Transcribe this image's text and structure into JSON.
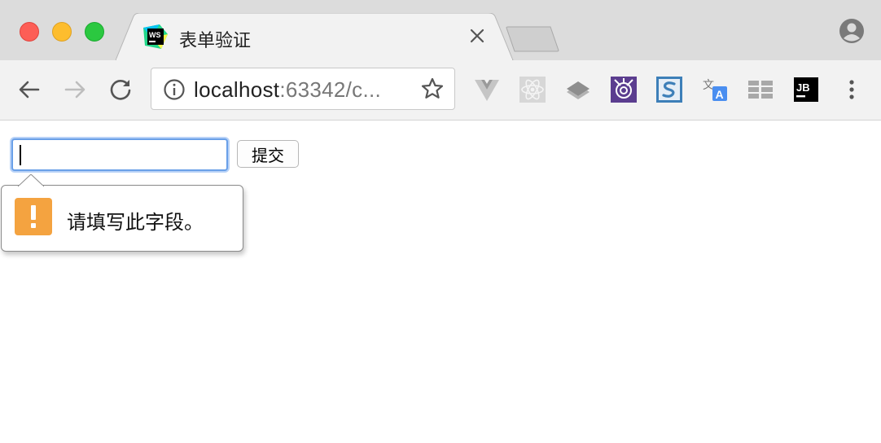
{
  "window": {
    "traffic_lights": [
      "close",
      "minimize",
      "zoom"
    ]
  },
  "tab": {
    "title": "表单验证",
    "favicon": "webstorm-icon",
    "favicon_text": "WS"
  },
  "toolbar": {
    "url_host": "localhost",
    "url_rest": ":63342/c...",
    "extensions": [
      "vue-devtools-icon",
      "react-devtools-icon",
      "layers-icon",
      "webgl-inspector-icon",
      "stylus-icon",
      "translate-icon",
      "grid-icon",
      "jetbrains-icon"
    ],
    "jetbrains_text": "JB",
    "translate_text": "文",
    "translate_letter": "A"
  },
  "form": {
    "input_value": "",
    "submit_label": "提交"
  },
  "validation": {
    "message": "请填写此字段。",
    "icon": "exclamation-icon"
  },
  "colors": {
    "accent_focus": "#6aa0e8",
    "warning": "#f4a340"
  }
}
